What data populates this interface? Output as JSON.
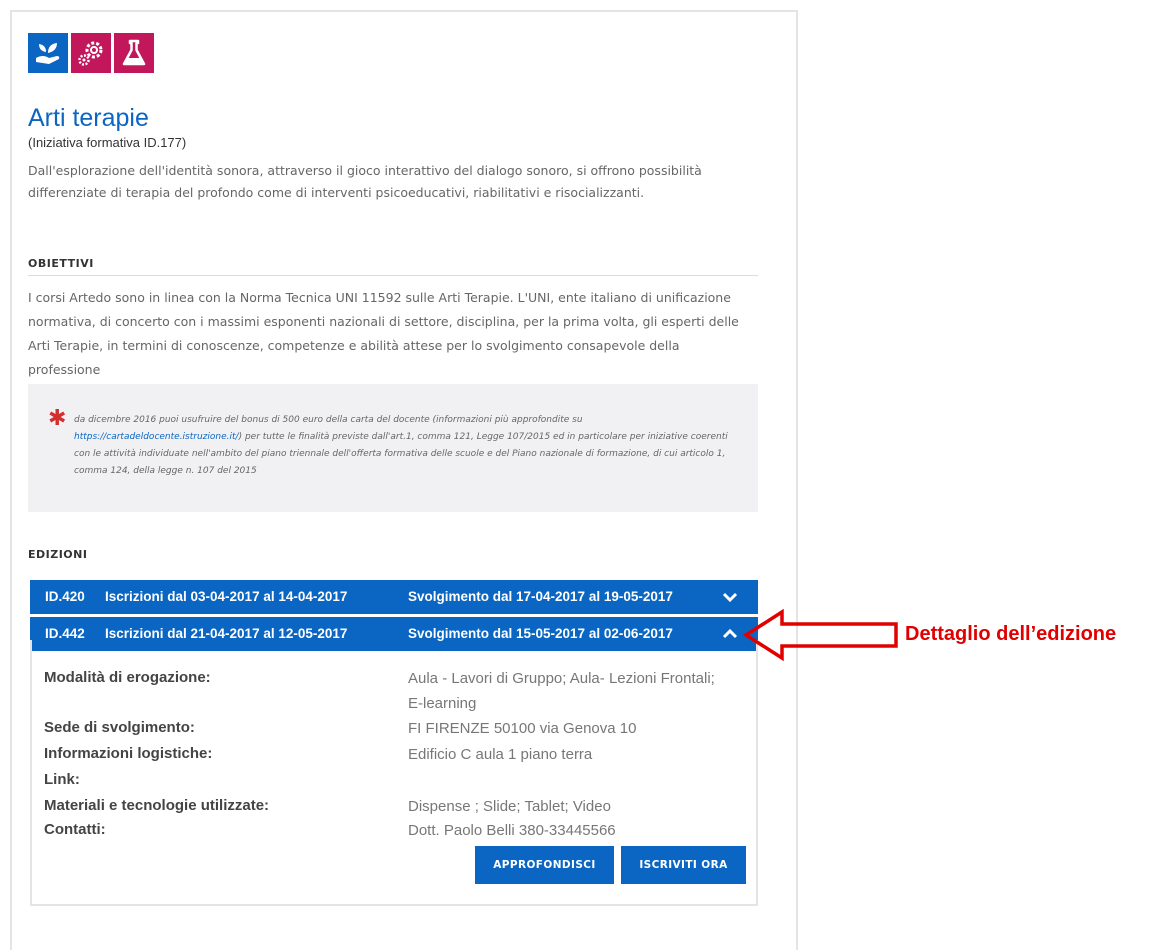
{
  "icons": [
    "plant-hand-icon",
    "gears-icon",
    "flask-icon"
  ],
  "colors": {
    "brand_blue": "#0a66c2",
    "icon_red": "#c2185b",
    "callout_red": "#e00000"
  },
  "course": {
    "title": "Arti terapie",
    "subtitle": "(Iniziativa formativa ID.177)",
    "description": "Dall'esplorazione dell'identità sonora, attraverso il gioco interattivo del dialogo sonoro, si offrono possibilità differenziate di terapia del profondo come di interventi psicoeducativi, riabilitativi e risocializzanti."
  },
  "objectives": {
    "heading": "OBIETTIVI",
    "text": "I corsi Artedo sono in linea con la Norma Tecnica UNI 11592 sulle Arti Terapie. L'UNI, ente italiano di unificazione normativa, di concerto con i massimi esponenti nazionali di settore, disciplina, per la prima volta, gli esperti delle Arti Terapie, in termini di conoscenze, competenze e abilità attese per lo svolgimento consapevole della professione"
  },
  "note": {
    "before_link": "da dicembre 2016 puoi usufruire del bonus di 500 euro della carta del docente (informazioni più approfondite su",
    "link": "https://cartadeldocente.istruzione.it/",
    "after_link": ") per tutte le finalità previste dall'art.1, comma 121, Legge 107/2015 ed in particolare per iniziative coerenti con le attività individuate nell'ambito del piano triennale dell'offerta formativa delle scuole e del Piano nazionale di formazione, di cui articolo 1, comma 124, della legge n. 107 del 2015"
  },
  "editions": {
    "heading": "EDIZIONI",
    "items": [
      {
        "id": "ID.420",
        "iscrizioni": "Iscrizioni dal 03-04-2017 al 14-04-2017",
        "svolgimento": "Svolgimento dal 17-04-2017 al 19-05-2017",
        "expanded": false
      },
      {
        "id": "ID.442",
        "iscrizioni": "Iscrizioni dal 21-04-2017 al 12-05-2017",
        "svolgimento": "Svolgimento dal 15-05-2017 al 02-06-2017",
        "expanded": true
      }
    ],
    "detail": {
      "rows": [
        {
          "label": "Modalità di erogazione:",
          "value": "Aula - Lavori di Gruppo; Aula- Lezioni Frontali; E-learning"
        },
        {
          "label": "Sede di svolgimento:",
          "value": "FI FIRENZE 50100 via Genova 10"
        },
        {
          "label": "Informazioni logistiche:",
          "value": "Edificio C aula 1 piano terra"
        },
        {
          "label": "Link:",
          "value": ""
        },
        {
          "label": "Materiali e tecnologie utilizzate:",
          "value": "Dispense ; Slide; Tablet; Video"
        },
        {
          "label": "Contatti:",
          "value": "Dott. Paolo Belli 380-33445566"
        }
      ],
      "buttons": {
        "more": "APPROFONDISCI",
        "enroll": "ISCRIVITI ORA"
      }
    }
  },
  "callout": "Dettaglio dell’edizione"
}
